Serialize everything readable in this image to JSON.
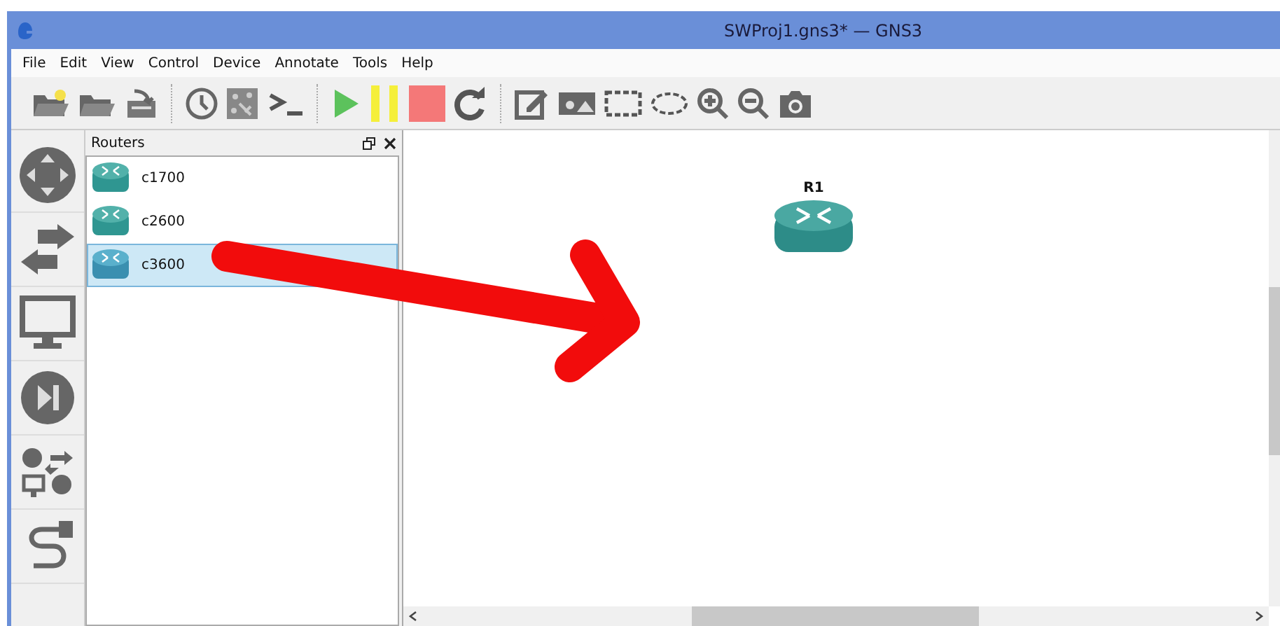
{
  "window": {
    "title": "SWProj1.gns3* — GNS3"
  },
  "menu": [
    "File",
    "Edit",
    "View",
    "Control",
    "Device",
    "Annotate",
    "Tools",
    "Help"
  ],
  "dock": {
    "title": "Routers",
    "items": [
      {
        "label": "c1700",
        "selected": false
      },
      {
        "label": "c2600",
        "selected": false
      },
      {
        "label": "c3600",
        "selected": true
      }
    ]
  },
  "canvas": {
    "nodes": [
      {
        "label": "R1"
      }
    ]
  }
}
